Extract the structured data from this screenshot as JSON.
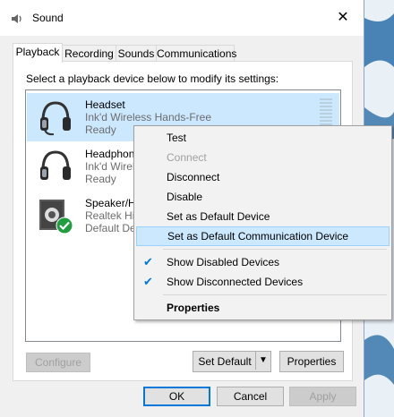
{
  "window": {
    "title": "Sound",
    "close_icon": "close-icon"
  },
  "tabs": [
    {
      "label": "Playback",
      "active": true
    },
    {
      "label": "Recording"
    },
    {
      "label": "Sounds"
    },
    {
      "label": "Communications"
    }
  ],
  "instructions": "Select a playback device below to modify its settings:",
  "devices": [
    {
      "name": "Headset",
      "description": "Ink'd Wireless Hands-Free",
      "status": "Ready",
      "icon": "headset-icon",
      "selected": true
    },
    {
      "name": "Headphon",
      "description": "Ink'd Wirele",
      "status": "Ready",
      "icon": "headphones-icon"
    },
    {
      "name": "Speaker/HP",
      "description": "Realtek Hig",
      "status": "Default Dev",
      "icon": "speaker-icon",
      "default_badge": "check-badge-icon"
    }
  ],
  "context_menu": {
    "items": [
      {
        "label": "Test"
      },
      {
        "label": "Connect",
        "disabled": true
      },
      {
        "label": "Disconnect"
      },
      {
        "label": "Disable"
      },
      {
        "label": "Set as Default Device"
      },
      {
        "label": "Set as Default Communication Device",
        "highlighted": true
      },
      {
        "label": "Show Disabled Devices",
        "checked": true
      },
      {
        "label": "Show Disconnected Devices",
        "checked": true
      },
      {
        "label": "Properties",
        "bold": true
      }
    ]
  },
  "buttons": {
    "configure": "Configure",
    "set_default": "Set Default",
    "properties": "Properties",
    "ok": "OK",
    "cancel": "Cancel",
    "apply": "Apply"
  },
  "colors": {
    "selection": "#cce8ff",
    "accent": "#0078d7",
    "badge": "#1e9e3e"
  }
}
